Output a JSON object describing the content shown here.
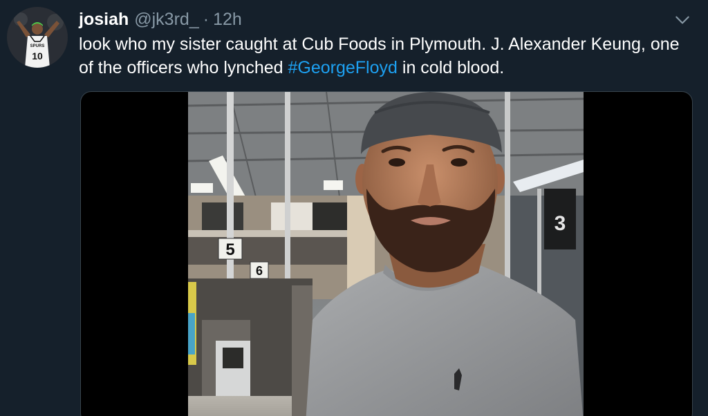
{
  "tweet": {
    "name": "josiah",
    "handle": "@jk3rd_",
    "separator": "·",
    "time": "12h",
    "text_part1": "look who my sister caught at Cub Foods in Plymouth. J. Alexander Keung, one of the officers who lynched ",
    "hashtag": "#GeorgeFloyd",
    "text_part2": " in cold blood."
  },
  "avatar": {
    "jersey_number": "10"
  },
  "media": {
    "aisle_sign_5": "5",
    "aisle_sign_6": "6",
    "aisle_sign_3": "3"
  },
  "icons": {
    "caret": "chevron-down-icon"
  },
  "colors": {
    "background": "#15202b",
    "text": "#ffffff",
    "secondary_text": "#8899a6",
    "link": "#1da1f2",
    "border": "#38444d"
  }
}
